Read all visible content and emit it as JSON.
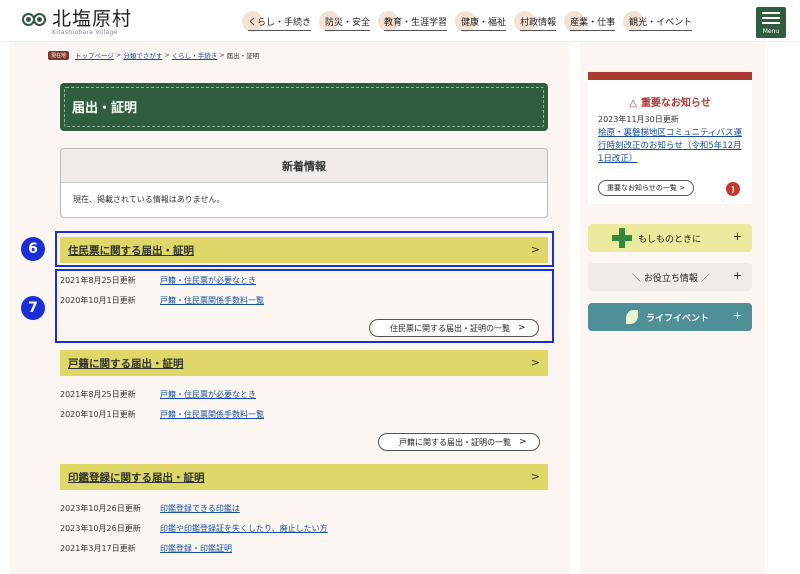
{
  "header": {
    "logo_title": "北塩原村",
    "logo_sub": "Kitashiobara Village",
    "nav": [
      "くらし・手続き",
      "防災・安全",
      "教育・生涯学習",
      "健康・福祉",
      "村政情報",
      "産業・仕事",
      "観光・イベント"
    ],
    "menu_label": "Menu"
  },
  "breadcrumb": {
    "badge": "現在地",
    "items": [
      "トップページ",
      "分類でさがす",
      "くらし・手続き"
    ],
    "current": "届出・証明",
    "sep": ">"
  },
  "page_title": "届出・証明",
  "news": {
    "heading": "新着情報",
    "body": "現在、掲載されている情報はありません。"
  },
  "sections": [
    {
      "title": "住民票に関する届出・証明",
      "rows": [
        {
          "date": "2021年8月25日更新",
          "link": "戸籍・住民票が必要なとき"
        },
        {
          "date": "2020年10月1日更新",
          "link": "戸籍・住民票関係手数料一覧"
        }
      ],
      "more": "住民票に関する届出・証明の一覧"
    },
    {
      "title": "戸籍に関する届出・証明",
      "rows": [
        {
          "date": "2021年8月25日更新",
          "link": "戸籍・住民票が必要なとき"
        },
        {
          "date": "2020年10月1日更新",
          "link": "戸籍・住民票関係手数料一覧"
        }
      ],
      "more": "戸籍に関する届出・証明の一覧"
    },
    {
      "title": "印鑑登録に関する届出・証明",
      "rows": [
        {
          "date": "2023年10月26日更新",
          "link": "印鑑登録できる印鑑は"
        },
        {
          "date": "2023年10月26日更新",
          "link": "印鑑や印鑑登録証を失くしたり、廃止したい方"
        },
        {
          "date": "2021年3月17日更新",
          "link": "印鑑登録・印鑑証明"
        }
      ]
    }
  ],
  "annotations": {
    "badge6": "6",
    "badge7": "7"
  },
  "chevron": ">",
  "important": {
    "title": "重要なお知らせ",
    "date": "2023年11月30日更新",
    "link": "桧原・裏磐梯地区コミュニティバス運行時刻改正のお知らせ（令和5年12月1日改正）",
    "list_btn": "重要なお知らせの一覧 >"
  },
  "side_buttons": {
    "emergency": "もしものときに",
    "useful": "＼ お役立ち情報 ／",
    "life": "ライフイベント",
    "plus": "+"
  },
  "colors": {
    "brand_green": "#2f5e3e",
    "section_yellow": "#dfd868",
    "alert_red": "#a83a30",
    "highlight_blue": "#1a2fd6"
  }
}
